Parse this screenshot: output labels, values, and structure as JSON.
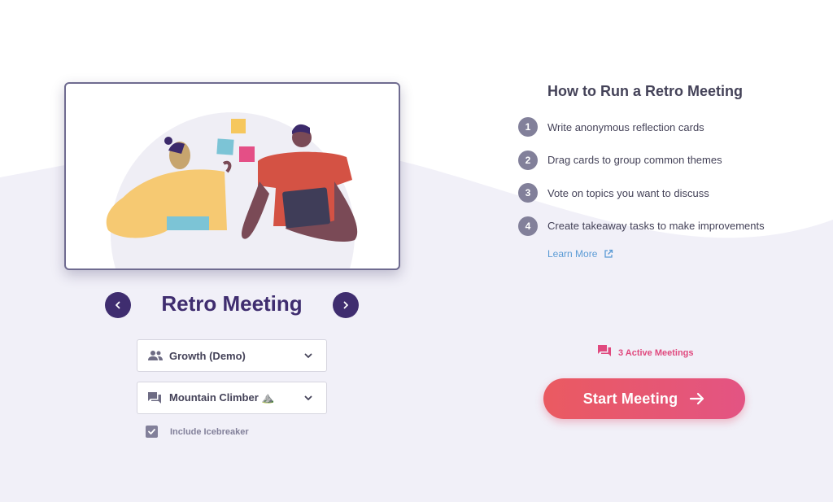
{
  "carousel": {
    "title": "Retro Meeting",
    "prev_icon": "chevron-left-icon",
    "next_icon": "chevron-right-icon"
  },
  "team_select": {
    "icon": "group-icon",
    "value": "Growth (Demo)"
  },
  "template_select": {
    "icon": "chat-icon",
    "value": "Mountain Climber ⛰️"
  },
  "icebreaker": {
    "label": "Include Icebreaker",
    "checked": true
  },
  "howto": {
    "title": "How to Run a Retro Meeting",
    "steps": [
      {
        "num": "1",
        "text": "Write anonymous reflection cards"
      },
      {
        "num": "2",
        "text": "Drag cards to group common themes"
      },
      {
        "num": "3",
        "text": "Vote on topics you want to discuss"
      },
      {
        "num": "4",
        "text": "Create takeaway tasks to make improvements"
      }
    ],
    "learn_more": "Learn More"
  },
  "active_meetings": {
    "text": "3 Active Meetings"
  },
  "start_button": {
    "label": "Start Meeting"
  },
  "colors": {
    "brand_purple": "#3f2d6f",
    "accent_pink": "#e0497e",
    "start_gradient_left": "#ea5a61",
    "start_gradient_right": "#e35483",
    "link_blue": "#5b9bd5",
    "muted_gray": "#82809a",
    "background_wave": "#f1f0f8"
  }
}
